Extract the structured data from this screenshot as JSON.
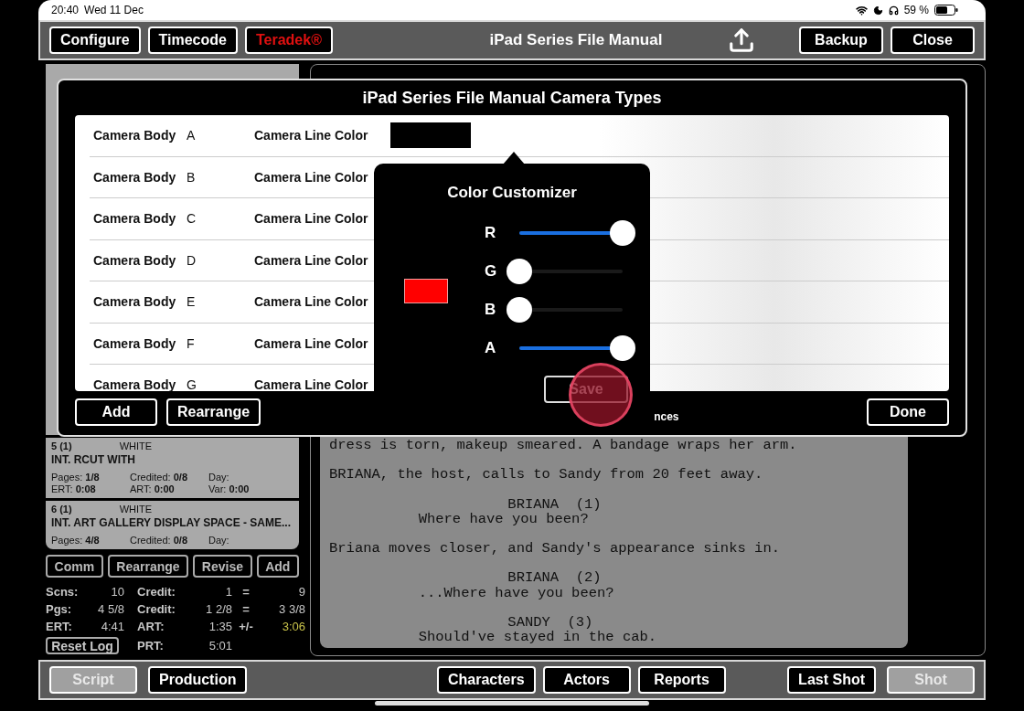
{
  "status_bar": {
    "time": "20:40",
    "date": "Wed 11 Dec",
    "battery": "59 %"
  },
  "toolbar": {
    "title": "iPad Series File Manual",
    "left_buttons": [
      {
        "label": "Configure",
        "kind": "normal"
      },
      {
        "label": "Timecode",
        "kind": "normal"
      },
      {
        "label": "Teradek®",
        "kind": "alert"
      }
    ],
    "right_buttons": [
      "Backup",
      "Close"
    ]
  },
  "scenes": [
    {
      "number": "5 (1)",
      "color_label": "WHITE",
      "heading": "INT. RCUT WITH",
      "fields": [
        {
          "label": "Pages:",
          "value": "1/8"
        },
        {
          "label": "Credited:",
          "value": "0/8"
        },
        {
          "label": "Day:"
        },
        {
          "label": "ERT:",
          "value": "0:08"
        },
        {
          "label": "ART:",
          "value": "0:00"
        },
        {
          "label": "Var:",
          "value": "0:00"
        }
      ]
    },
    {
      "number": "6 (1)",
      "color_label": "WHITE",
      "heading": "INT. ART GALLERY DISPLAY SPACE - SAME...",
      "fields": [
        {
          "label": "Pages:",
          "value": "4/8"
        },
        {
          "label": "Credited:",
          "value": "0/8"
        },
        {
          "label": "Day:"
        }
      ]
    }
  ],
  "scene_buttons": [
    "Comm",
    "Rearrange",
    "Revise",
    "Add"
  ],
  "stats": [
    {
      "label": "Scns:",
      "value": "10",
      "label_2": "Credit:",
      "value_2": "1",
      "operator": "=",
      "result": "9",
      "highlight": false
    },
    {
      "label": "Pgs:",
      "value": "4 5/8",
      "label_2": "Credit:",
      "value_2": "1 2/8",
      "operator": "=",
      "result": "3 3/8",
      "highlight": false
    },
    {
      "label": "ERT:",
      "value": "4:41",
      "label_2": "ART:",
      "value_2": "1:35",
      "operator": "+/-",
      "result": "3:06",
      "highlight": true
    }
  ],
  "reset_button": "Reset Log",
  "prt": {
    "label": "PRT:",
    "value": "5:01"
  },
  "script": [
    {
      "kind": "action",
      "text": "dress is torn, makeup smeared. A bandage wraps her arm."
    },
    {
      "kind": "action",
      "text": "BRIANA, the host, calls to Sandy from 20 feet away."
    },
    {
      "kind": "character",
      "text": "BRIANA  (1)"
    },
    {
      "kind": "dialogue",
      "text": "Where have you been?"
    },
    {
      "kind": "action",
      "text": "Briana moves closer, and Sandy's appearance sinks in."
    },
    {
      "kind": "character",
      "text": "BRIANA  (2)"
    },
    {
      "kind": "dialogue",
      "text": "...Where have you been?"
    },
    {
      "kind": "character",
      "text": "SANDY  (3)"
    },
    {
      "kind": "dialogue",
      "text": "Should've stayed in the cab."
    }
  ],
  "modal": {
    "title": "iPad Series File Manual Camera Types",
    "rows": [
      {
        "body_label": "Camera Body",
        "letter": "A",
        "color_label": "Camera Line Color",
        "color": "#000000"
      },
      {
        "body_label": "Camera Body",
        "letter": "B",
        "color_label": "Camera Line Color"
      },
      {
        "body_label": "Camera Body",
        "letter": "C",
        "color_label": "Camera Line Color"
      },
      {
        "body_label": "Camera Body",
        "letter": "D",
        "color_label": "Camera Line Color"
      },
      {
        "body_label": "Camera Body",
        "letter": "E",
        "color_label": "Camera Line Color"
      },
      {
        "body_label": "Camera Body",
        "letter": "F",
        "color_label": "Camera Line Color"
      },
      {
        "body_label": "Camera Body",
        "letter": "G",
        "color_label": "Camera Line Color"
      }
    ],
    "left_buttons": [
      "Add",
      "Rearrange"
    ],
    "partial_label": "nces",
    "done_button": "Done"
  },
  "popover": {
    "title": "Color Customizer",
    "sliders": [
      {
        "label": "R",
        "level": 1
      },
      {
        "label": "G",
        "level": 0
      },
      {
        "label": "B",
        "level": 0
      },
      {
        "label": "A",
        "level": 1
      }
    ],
    "save_button": "Save"
  },
  "bottom_bar": {
    "left": [
      {
        "label": "Script",
        "selected": true
      },
      {
        "label": "Production",
        "selected": false
      }
    ],
    "center": [
      "Characters",
      "Actors",
      "Reports"
    ],
    "right": [
      {
        "label": "Last Shot",
        "disabled": false
      },
      {
        "label": "Shot",
        "disabled": true
      }
    ]
  }
}
